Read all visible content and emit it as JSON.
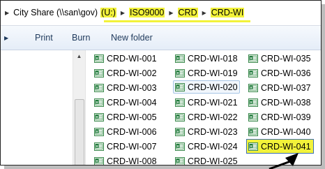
{
  "address": {
    "root": "City Share (\\\\san\\gov)",
    "drive": "(U:)",
    "crumbs": [
      "ISO9000",
      "CRD",
      "CRD-WI"
    ]
  },
  "toolbar": {
    "print": "Print",
    "burn": "Burn",
    "new_folder": "New folder"
  },
  "files": [
    [
      "CRD-WI-001",
      "CRD-WI-002",
      "CRD-WI-003",
      "CRD-WI-004",
      "CRD-WI-005",
      "CRD-WI-006",
      "CRD-WI-007",
      "CRD-WI-008"
    ],
    [
      "CRD-WI-018",
      "CRD-WI-019",
      "CRD-WI-020",
      "CRD-WI-021",
      "CRD-WI-022",
      "CRD-WI-023",
      "CRD-WI-024",
      "CRD-WI-025"
    ],
    [
      "CRD-WI-035",
      "CRD-WI-036",
      "CRD-WI-037",
      "CRD-WI-038",
      "CRD-WI-039",
      "CRD-WI-040",
      "CRD-WI-041"
    ]
  ],
  "colors": {
    "highlight": "#f2f23a",
    "excel_green": "#1f7a3a",
    "selection_border": "#a7c6e6"
  },
  "icons": {
    "file": "excel-spreadsheet-icon",
    "pointer": "arrow-annotation"
  }
}
